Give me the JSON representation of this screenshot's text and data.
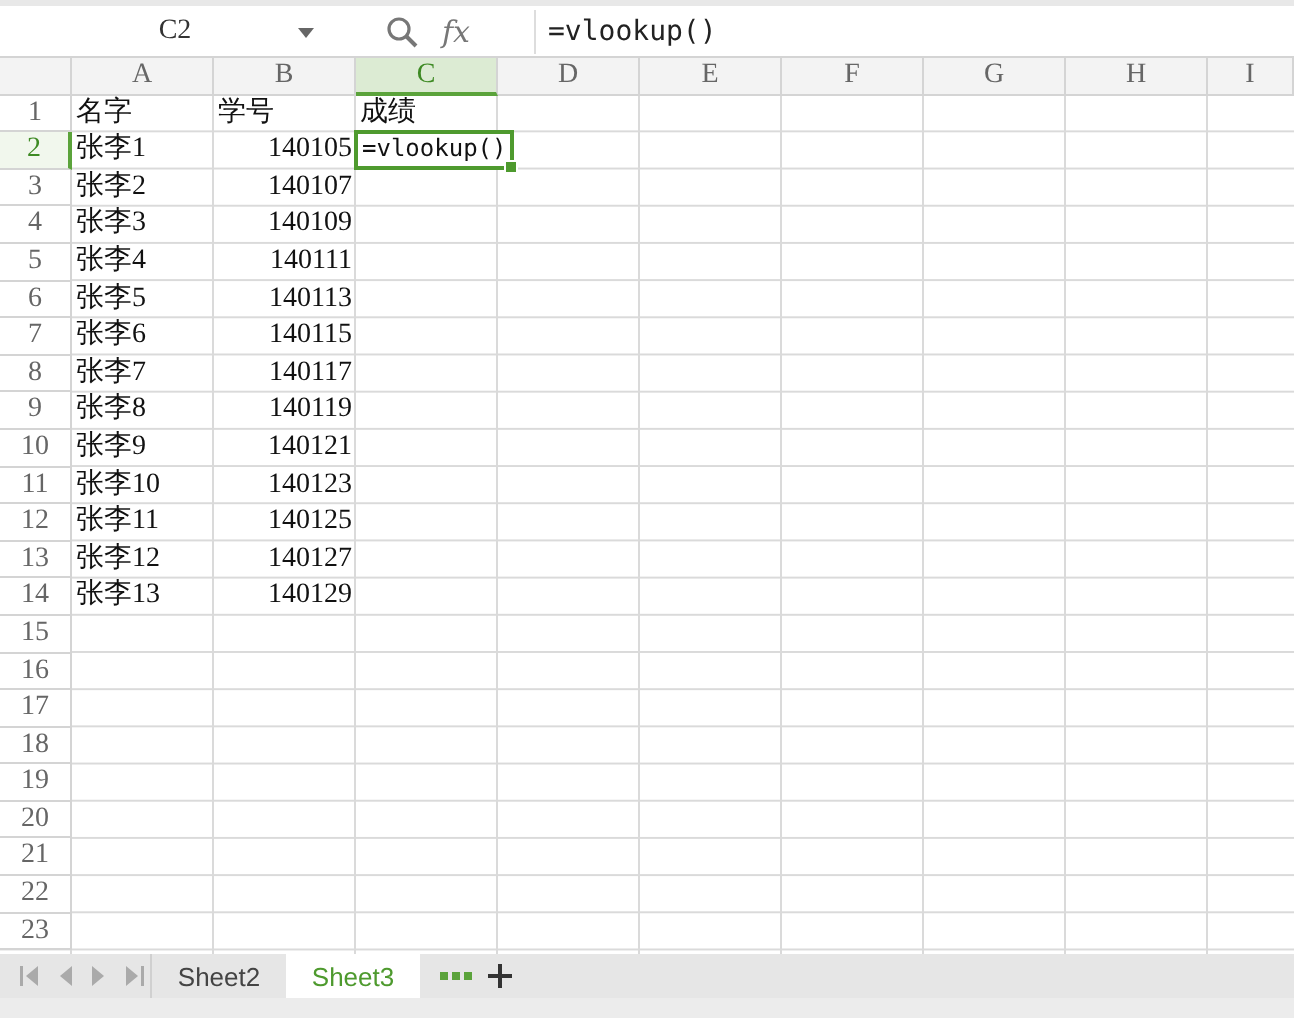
{
  "formula_bar": {
    "name_box": "C2",
    "function_label": "fx",
    "formula": "=vlookup()"
  },
  "columns": [
    {
      "label": "A",
      "selected": false
    },
    {
      "label": "B",
      "selected": false
    },
    {
      "label": "C",
      "selected": true
    },
    {
      "label": "D",
      "selected": false
    },
    {
      "label": "E",
      "selected": false
    },
    {
      "label": "F",
      "selected": false
    },
    {
      "label": "G",
      "selected": false
    },
    {
      "label": "H",
      "selected": false
    },
    {
      "label": "I",
      "selected": false
    }
  ],
  "rows": [
    {
      "number": "1",
      "selected": false,
      "cells": [
        {
          "text": "名字",
          "kind": "text"
        },
        {
          "text": "学号",
          "kind": "text"
        },
        {
          "text": "成绩",
          "kind": "text"
        }
      ]
    },
    {
      "number": "2",
      "selected": true,
      "cells": [
        {
          "text": "张李1",
          "kind": "text"
        },
        {
          "text": "140105",
          "kind": "number"
        },
        {
          "text": "=vlookup()",
          "kind": "editing"
        }
      ]
    },
    {
      "number": "3",
      "selected": false,
      "cells": [
        {
          "text": "张李2",
          "kind": "text"
        },
        {
          "text": "140107",
          "kind": "number"
        }
      ]
    },
    {
      "number": "4",
      "selected": false,
      "cells": [
        {
          "text": "张李3",
          "kind": "text"
        },
        {
          "text": "140109",
          "kind": "number"
        }
      ]
    },
    {
      "number": "5",
      "selected": false,
      "cells": [
        {
          "text": "张李4",
          "kind": "text"
        },
        {
          "text": "140111",
          "kind": "number"
        }
      ]
    },
    {
      "number": "6",
      "selected": false,
      "cells": [
        {
          "text": "张李5",
          "kind": "text"
        },
        {
          "text": "140113",
          "kind": "number"
        }
      ]
    },
    {
      "number": "7",
      "selected": false,
      "cells": [
        {
          "text": "张李6",
          "kind": "text"
        },
        {
          "text": "140115",
          "kind": "number"
        }
      ]
    },
    {
      "number": "8",
      "selected": false,
      "cells": [
        {
          "text": "张李7",
          "kind": "text"
        },
        {
          "text": "140117",
          "kind": "number"
        }
      ]
    },
    {
      "number": "9",
      "selected": false,
      "cells": [
        {
          "text": "张李8",
          "kind": "text"
        },
        {
          "text": "140119",
          "kind": "number"
        }
      ]
    },
    {
      "number": "10",
      "selected": false,
      "cells": [
        {
          "text": "张李9",
          "kind": "text"
        },
        {
          "text": "140121",
          "kind": "number"
        }
      ]
    },
    {
      "number": "11",
      "selected": false,
      "cells": [
        {
          "text": "张李10",
          "kind": "text"
        },
        {
          "text": "140123",
          "kind": "number"
        }
      ]
    },
    {
      "number": "12",
      "selected": false,
      "cells": [
        {
          "text": "张李11",
          "kind": "text"
        },
        {
          "text": "140125",
          "kind": "number"
        }
      ]
    },
    {
      "number": "13",
      "selected": false,
      "cells": [
        {
          "text": "张李12",
          "kind": "text"
        },
        {
          "text": "140127",
          "kind": "number"
        }
      ]
    },
    {
      "number": "14",
      "selected": false,
      "cells": [
        {
          "text": "张李13",
          "kind": "text"
        },
        {
          "text": "140129",
          "kind": "number"
        }
      ]
    },
    {
      "number": "15",
      "selected": false
    },
    {
      "number": "16",
      "selected": false
    },
    {
      "number": "17",
      "selected": false
    },
    {
      "number": "18",
      "selected": false
    },
    {
      "number": "19",
      "selected": false
    },
    {
      "number": "20",
      "selected": false
    },
    {
      "number": "21",
      "selected": false
    },
    {
      "number": "22",
      "selected": false
    },
    {
      "number": "23",
      "selected": false
    }
  ],
  "sheet_tabs": [
    {
      "label": "Sheet2",
      "selected": false
    },
    {
      "label": "Sheet3",
      "selected": true
    }
  ]
}
